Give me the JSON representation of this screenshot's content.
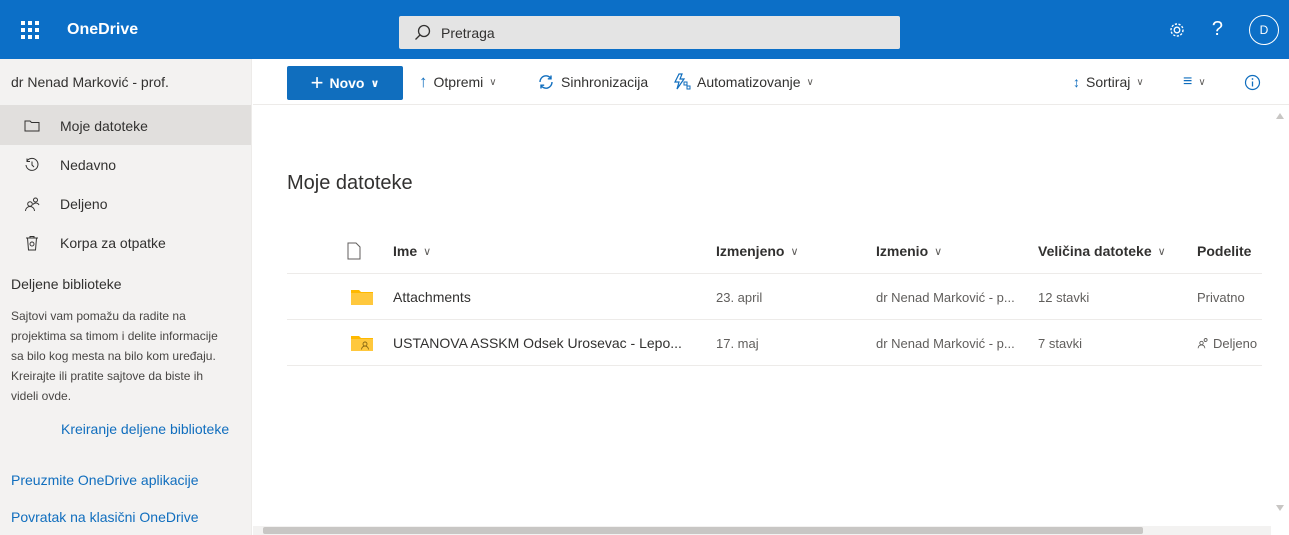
{
  "topbar": {
    "brand": "OneDrive",
    "search_placeholder": "Pretraga",
    "avatar_initial": "D",
    "help": "?"
  },
  "sidebar": {
    "user_name": "dr Nenad Marković - prof.",
    "items": [
      {
        "label": "Moje datoteke",
        "icon": "folder-icon",
        "active": true
      },
      {
        "label": "Nedavno",
        "icon": "history-icon",
        "active": false
      },
      {
        "label": "Deljeno",
        "icon": "people-icon",
        "active": false
      },
      {
        "label": "Korpa za otpatke",
        "icon": "recycle-bin-icon",
        "active": false
      }
    ],
    "section_title": "Deljene biblioteke",
    "section_desc": "Sajtovi vam pomažu da radite na projektima sa timom i delite informacije sa bilo kog mesta na bilo kom uređaju. Kreirajte ili pratite sajtove da biste ih videli ovde.",
    "create_library": "Kreiranje deljene biblioteke",
    "get_apps": "Preuzmite OneDrive aplikacije",
    "back_classic": "Povratak na klasični OneDrive"
  },
  "commandbar": {
    "new": "Novo",
    "upload": "Otpremi",
    "sync": "Sinhronizacija",
    "automate": "Automatizovanje",
    "sort": "Sortiraj"
  },
  "main": {
    "title": "Moje datoteke",
    "columns": {
      "name": "Ime",
      "modified": "Izmenjeno",
      "modified_by": "Izmenio",
      "size": "Veličina datoteke",
      "sharing": "Podelite"
    },
    "rows": [
      {
        "name": "Attachments",
        "modified": "23. april",
        "modified_by": "dr Nenad Marković - p...",
        "size": "12 stavki",
        "sharing": "Privatno",
        "shared": false
      },
      {
        "name": "USTANOVA ASSKM Odsek Urosevac - Lepo...",
        "modified": "17. maj",
        "modified_by": "dr Nenad Marković - p...",
        "size": "7 stavki",
        "sharing": "Deljeno",
        "shared": true
      }
    ]
  },
  "colors": {
    "brand_blue": "#106ebe",
    "folder_yellow": "#ffb900",
    "sidebar_bg": "#f3f2f1"
  }
}
